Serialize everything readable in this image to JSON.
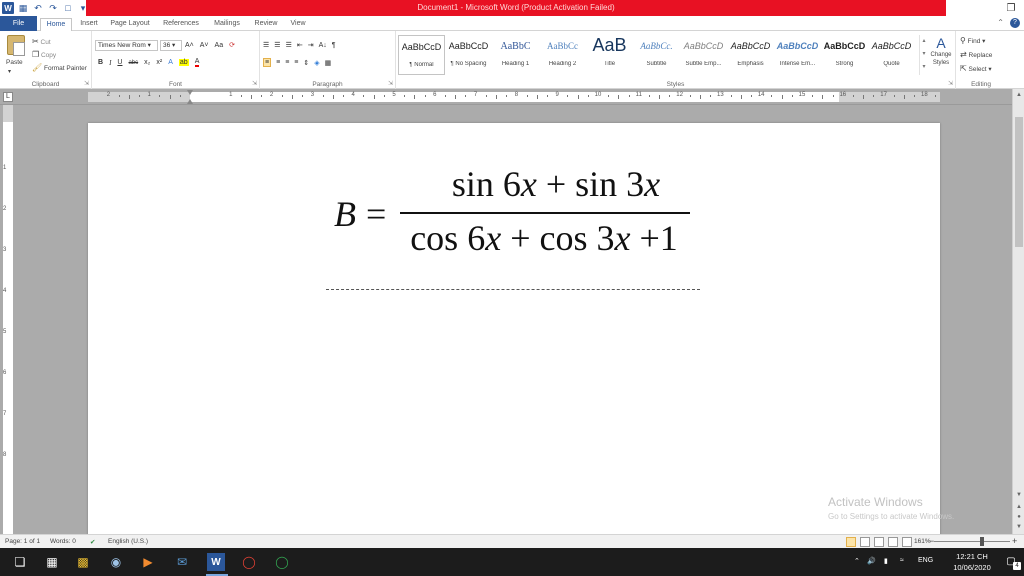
{
  "window": {
    "title": "Document1 - Microsoft Word (Product Activation Failed)",
    "app_icon_label": "W",
    "minimize_glyph": "─",
    "maximize_glyph": "□",
    "close_glyph": "✕",
    "title_bar_color": "#e81123"
  },
  "quick_access": {
    "save_glyph": "💾",
    "undo_glyph": "↶",
    "redo_glyph": "↷",
    "new_glyph": "🗎",
    "customize_glyph": "▾"
  },
  "tabs": [
    {
      "label": "File"
    },
    {
      "label": "Home"
    },
    {
      "label": "Insert"
    },
    {
      "label": "Page Layout"
    },
    {
      "label": "References"
    },
    {
      "label": "Mailings"
    },
    {
      "label": "Review"
    },
    {
      "label": "View"
    }
  ],
  "ribbon": {
    "clipboard": {
      "paste": "Paste",
      "cut": "Cut",
      "copy": "Copy",
      "format_painter": "Format Painter",
      "group_label": "Clipboard"
    },
    "font": {
      "font_name": "Times New Rom",
      "font_size": "36",
      "group_label": "Font",
      "bold": "B",
      "italic": "I",
      "underline": "U",
      "strike": "abc",
      "subscript": "x₂",
      "superscript": "x²",
      "grow": "A˄",
      "shrink": "A˅",
      "change_case": "Aa",
      "text_effects": "A",
      "highlight": "ab",
      "font_color": "A"
    },
    "paragraph": {
      "group_label": "Paragraph",
      "show_marks": "¶",
      "sort": "A↓"
    },
    "styles": {
      "group_label": "Styles",
      "change_styles": "Change Styles",
      "items": [
        {
          "preview": "AaBbCcD",
          "name": "¶ Normal"
        },
        {
          "preview": "AaBbCcD",
          "name": "¶ No Spacing"
        },
        {
          "preview": "AaBbC",
          "name": "Heading 1"
        },
        {
          "preview": "AaBbCc",
          "name": "Heading 2"
        },
        {
          "preview": "AaB",
          "name": "Title"
        },
        {
          "preview": "AaBbCc.",
          "name": "Subtitle"
        },
        {
          "preview": "AaBbCcD",
          "name": "Subtle Emp..."
        },
        {
          "preview": "AaBbCcD",
          "name": "Emphasis"
        },
        {
          "preview": "AaBbCcD",
          "name": "Intense Em..."
        },
        {
          "preview": "AaBbCcD",
          "name": "Strong"
        },
        {
          "preview": "AaBbCcD",
          "name": "Quote"
        }
      ]
    },
    "editing": {
      "group_label": "Editing",
      "find": "Find",
      "replace": "Replace",
      "select": "Select"
    }
  },
  "ruler": {
    "tab_selector": "L",
    "numbers": [
      "2",
      "1",
      "1",
      "2",
      "3",
      "4",
      "5",
      "6",
      "7",
      "8",
      "9",
      "10",
      "11",
      "12",
      "13",
      "14",
      "15",
      "16",
      "17",
      "18"
    ],
    "v_numbers": [
      "1",
      "2",
      "3",
      "4",
      "5",
      "6",
      "7",
      "8"
    ]
  },
  "document": {
    "equation": {
      "lhs": "B",
      "equals": "=",
      "numerator": {
        "func1": "sin",
        "coef1": "6",
        "var1": "x",
        "op": "+",
        "func2": "sin",
        "coef2": "3",
        "var2": "x"
      },
      "denominator": {
        "func1": "cos",
        "coef1": "6",
        "var1": "x",
        "op1": "+",
        "func2": "cos",
        "coef2": "3",
        "var2": "x",
        "op2": "+",
        "const": "1"
      }
    }
  },
  "watermark": {
    "title": "Activate Windows",
    "subtitle": "Go to Settings to activate Windows."
  },
  "statusbar": {
    "page": "Page: 1 of 1",
    "words": "Words: 0",
    "language": "English (U.S.)",
    "zoom": "161%",
    "zoom_out": "−",
    "zoom_in": "+"
  },
  "taskbar": {
    "time": "12:21 CH",
    "date": "10/06/2020",
    "language": "ENG",
    "notifications_count": "4",
    "apps": [
      {
        "icon": "windows-start-icon"
      },
      {
        "icon": "file-explorer-icon"
      },
      {
        "icon": "camera-icon"
      },
      {
        "icon": "media-player-icon"
      },
      {
        "icon": "mail-icon"
      },
      {
        "icon": "word-icon"
      },
      {
        "icon": "chrome-icon"
      },
      {
        "icon": "chrome-alt-icon"
      }
    ]
  }
}
